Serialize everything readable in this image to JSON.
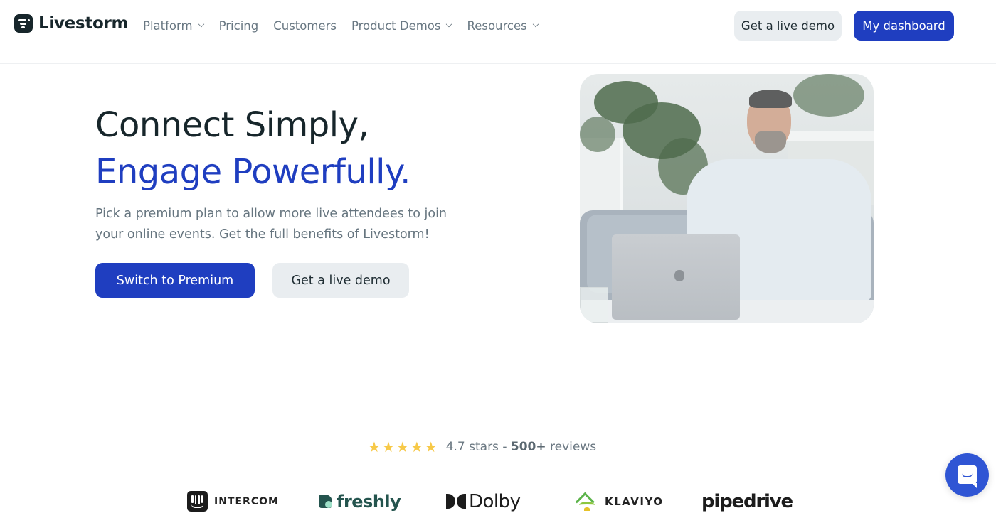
{
  "header": {
    "brand": "Livestorm",
    "nav": [
      {
        "label": "Platform",
        "has_dropdown": true
      },
      {
        "label": "Pricing",
        "has_dropdown": false
      },
      {
        "label": "Customers",
        "has_dropdown": false
      },
      {
        "label": "Product Demos",
        "has_dropdown": true
      },
      {
        "label": "Resources",
        "has_dropdown": true
      }
    ],
    "demo_button": "Get a live demo",
    "dashboard_button": "My dashboard"
  },
  "hero": {
    "title_line1": "Connect Simply,",
    "title_line2": "Engage Powerfully.",
    "subtitle": "Pick a premium plan to allow more live attendees to join your online events. Get the full benefits of Livestorm!",
    "primary_cta": "Switch to Premium",
    "secondary_cta": "Get a live demo",
    "image_description": "Man in white shirt on a sofa speaking to a laptop"
  },
  "reviews": {
    "rating": 4.7,
    "max_rating": 5,
    "rating_text": "4.7 stars - ",
    "count_text": "500+",
    "suffix_text": " reviews"
  },
  "logos": [
    "INTERCOM",
    "freshly",
    "Dolby",
    "KLAVIYO",
    "pipedrive"
  ],
  "chat_launcher": {
    "icon": "chat-bubble-icon"
  },
  "colors": {
    "brand_blue": "#1f3ec0",
    "dark_text": "#17262b",
    "muted_text": "#687782",
    "secondary_button_bg": "#e9edf0",
    "star": "#f7c948",
    "chat_blue": "#2f55d4"
  }
}
